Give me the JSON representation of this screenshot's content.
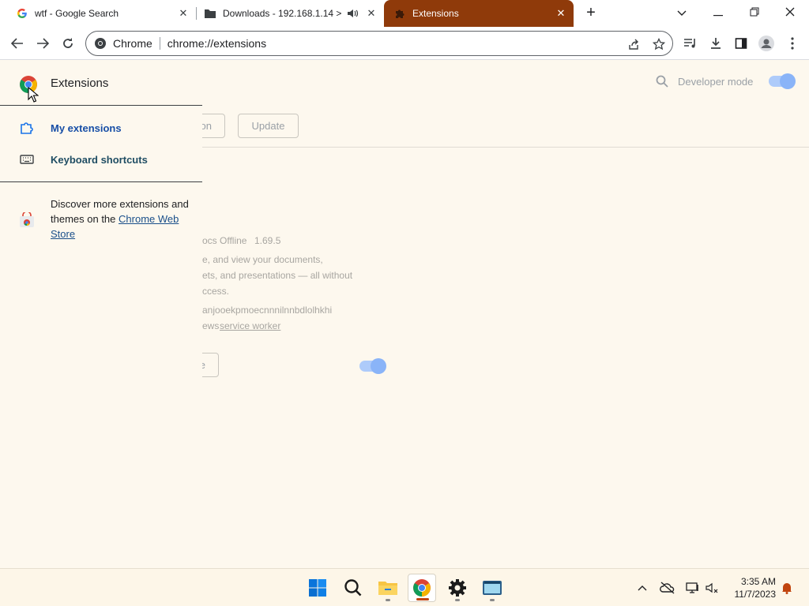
{
  "tabs": [
    {
      "title": "wtf - Google Search",
      "icon": "google-icon"
    },
    {
      "title": "Downloads - 192.168.1.14 >",
      "icon": "folder-icon",
      "audio": "speaker-icon"
    },
    {
      "title": "Extensions",
      "icon": "puzzle-icon",
      "active": true
    }
  ],
  "toolbar": {
    "omnibox_site": "Chrome",
    "omnibox_url": "chrome://extensions"
  },
  "page": {
    "developer_mode_label": "Developer mode",
    "developer_mode_on": true,
    "pack_button_partial": "on",
    "update_button": "Update"
  },
  "extension_card": {
    "name_partial": "ocs Offline",
    "version": "1.69.5",
    "desc_line1": "e, and view your documents,",
    "desc_line2": "ets, and presentations — all without",
    "desc_line3": "ccess.",
    "id_partial": "anjooekpmoecnnnilnnbdlolhkhi",
    "views_partial": "ews",
    "views_link": "service worker",
    "remove_partial": "e",
    "enabled": true
  },
  "drawer": {
    "title": "Extensions",
    "items": [
      {
        "label": "My extensions",
        "icon": "extension-icon"
      },
      {
        "label": "Keyboard shortcuts",
        "icon": "keyboard-icon"
      }
    ],
    "discover_text": "Discover more extensions and themes on the",
    "discover_link": "Chrome Web Store"
  },
  "taskbar": {
    "time": "3:35 AM",
    "date": "11/7/2023"
  },
  "colors": {
    "active_tab": "#8f3a0a",
    "page_bg": "#fdf8ee",
    "accent": "#1a73e8"
  }
}
